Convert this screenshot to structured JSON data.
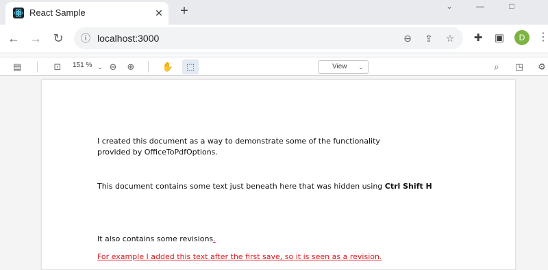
{
  "browser": {
    "tab": {
      "title": "React Sample",
      "close": "✕"
    },
    "new_tab": "+",
    "window": {
      "minimize": "⌄",
      "restore": "—",
      "maximize": "□"
    },
    "address": {
      "url": "localhost:3000"
    },
    "avatar": "D",
    "menu": "⋮"
  },
  "pdf_viewer": {
    "zoom": "151 %",
    "view_label": "View"
  },
  "document": {
    "paragraph_1": "I created this document as a way to demonstrate some of the functionality provided by OfficeToPdfOptions.",
    "paragraph_2_text": "This document contains some text just beneath here that was hidden using ",
    "paragraph_2_bold": "Ctrl Shift H",
    "paragraph_3": "It also contains some revisions",
    "paragraph_3_mark": ".",
    "revision_text": "For example I added this text after the first save, so it is seen as a revision."
  },
  "colors": {
    "revision": "#d71920",
    "avatar": "#7cb342"
  }
}
